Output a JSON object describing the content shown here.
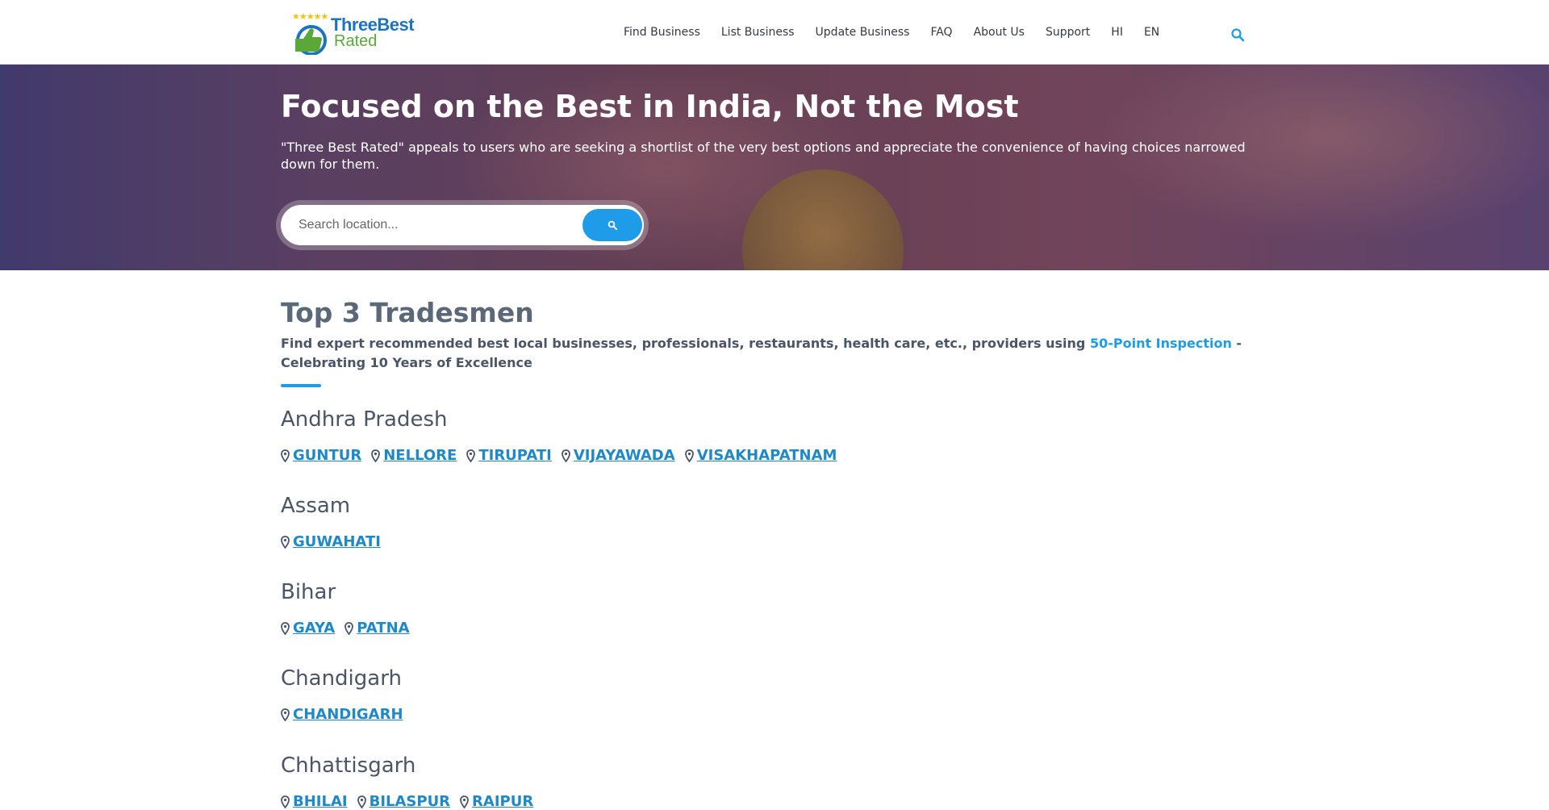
{
  "header": {
    "logo": {
      "line1": "ThreeBest",
      "line2": "Rated",
      "stars": "★★★★★"
    },
    "nav": [
      "Find Business",
      "List Business",
      "Update Business",
      "FAQ",
      "About Us",
      "Support",
      "HI",
      "EN"
    ]
  },
  "hero": {
    "title": "Focused on the Best in India, Not the Most",
    "subtitle": "\"Three Best Rated\" appeals to users who are seeking a shortlist of the very best options and appreciate the convenience of having choices narrowed down for them.",
    "search": {
      "placeholder": "Search location..."
    }
  },
  "main": {
    "title": "Top 3 Tradesmen",
    "lead_before": "Find expert recommended best local businesses, professionals, restaurants, health care, etc., providers using ",
    "lead_link": "50-Point Inspection",
    "lead_after": " - Celebrating 10 Years of Excellence",
    "states": [
      {
        "name": "Andhra Pradesh",
        "cities": [
          "GUNTUR",
          "NELLORE",
          "TIRUPATI",
          "VIJAYAWADA",
          "VISAKHAPATNAM"
        ]
      },
      {
        "name": "Assam",
        "cities": [
          "GUWAHATI"
        ]
      },
      {
        "name": "Bihar",
        "cities": [
          "GAYA",
          "PATNA"
        ]
      },
      {
        "name": "Chandigarh",
        "cities": [
          "CHANDIGARH"
        ]
      },
      {
        "name": "Chhattisgarh",
        "cities": [
          "BHILAI",
          "BILASPUR",
          "RAIPUR"
        ]
      }
    ]
  },
  "colors": {
    "accent": "#1e9be9",
    "link": "#1e88c8",
    "text": "#4a5568"
  }
}
